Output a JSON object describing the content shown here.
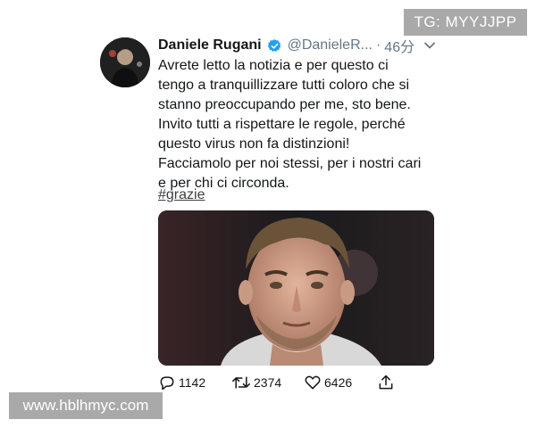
{
  "watermarks": {
    "top": "TG: MYYJJPP",
    "bottom": "www.hblhmyc.com"
  },
  "tweet": {
    "author": {
      "name": "Daniele Rugani",
      "handle": "@DanieleR...",
      "verified": true,
      "avatar_icon": "profile-photo"
    },
    "separator": "·",
    "time": "46分",
    "text_lines": [
      "Avrete letto la notizia e per questo ci",
      "tengo a tranquillizzare tutti coloro che si",
      "stanno preoccupando per me, sto bene.",
      "Invito tutti a rispettare le regole, perché",
      "questo virus non fa distinzioni!",
      "Facciamolo per noi stessi, per i nostri cari",
      "e per chi ci circonda."
    ],
    "hashtag": "#grazie",
    "media_icon": "player-portrait-photo",
    "actions": {
      "reply": {
        "icon": "reply-icon",
        "count": "1142"
      },
      "retweet": {
        "icon": "retweet-icon",
        "count": "2374"
      },
      "like": {
        "icon": "heart-icon",
        "count": "6426"
      },
      "share": {
        "icon": "share-icon"
      }
    },
    "colors": {
      "verified": "#1da1f2",
      "secondary_text": "#657786"
    }
  }
}
